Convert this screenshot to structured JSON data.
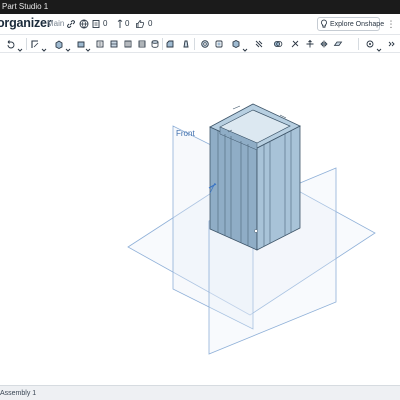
{
  "window": {
    "title": "Part Studio 1"
  },
  "document": {
    "name": "organizer",
    "branch": "Main",
    "versions_count": "0",
    "branches_count": "0",
    "likes_count": "0",
    "explore_label": "Explore Onshape"
  },
  "toolbar": {
    "icons": [
      "undo-icon",
      "sketch-icon",
      "extrude-icon",
      "revolve-icon",
      "sweep-icon",
      "loft-icon",
      "thicken-icon",
      "enclose-icon",
      "fillet-icon",
      "chamfer-icon",
      "draft-icon",
      "rib-icon",
      "shell-icon",
      "hole-icon",
      "linear-pattern-icon",
      "boolean-icon",
      "split-icon",
      "transform-icon",
      "mirror-icon",
      "plane-icon",
      "mate-connector-icon",
      "more-icon"
    ]
  },
  "viewport": {
    "plane_label": "Front",
    "plane_color": "#8fb0d8",
    "part_color": "#9fbad0"
  },
  "bottom_tabs": {
    "active": "Assembly 1"
  }
}
